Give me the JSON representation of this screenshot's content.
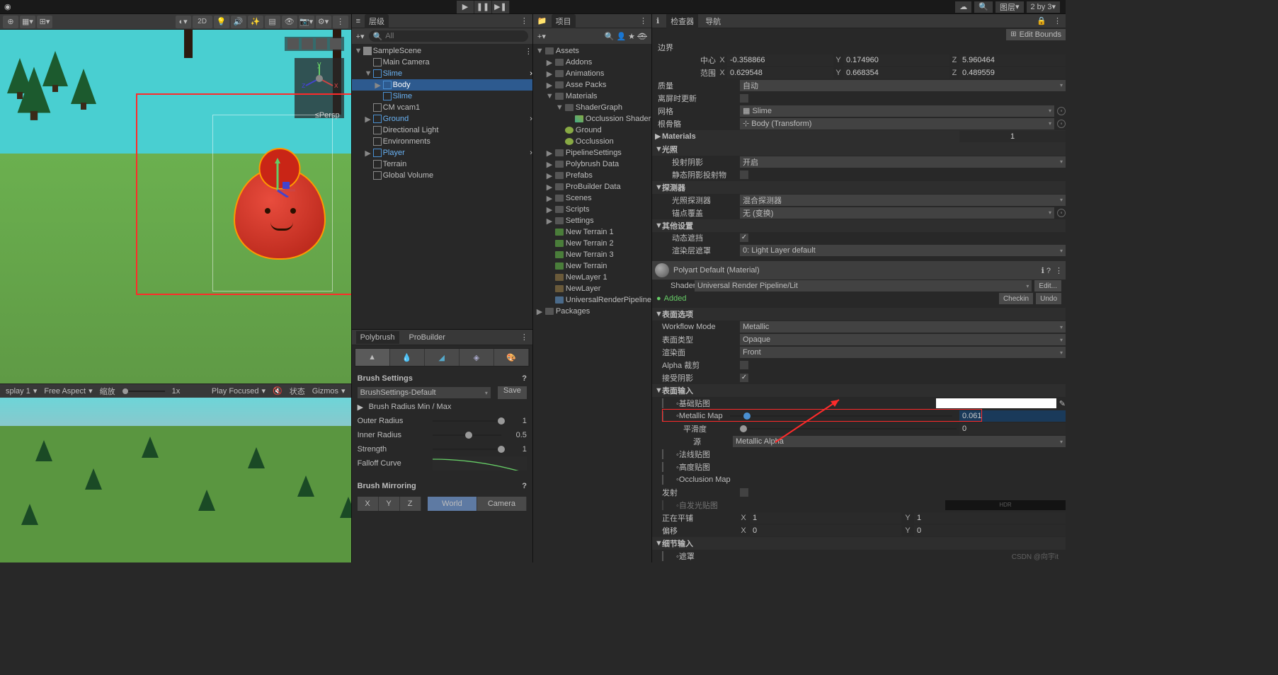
{
  "topbar": {
    "layout_dropdown": "图层",
    "ratio": "2 by 3"
  },
  "scene": {
    "persp": "≤Persp"
  },
  "gamebar": {
    "display": "splay 1",
    "aspect": "Free Aspect",
    "scale_label": "缩放",
    "scale_value": "1x",
    "playmode": "Play Focused",
    "status": "状态",
    "gizmos": "Gizmos"
  },
  "hierarchy": {
    "title": "层级",
    "search_placeholder": "All",
    "scene": "SampleScene",
    "items": [
      "Main Camera",
      "Slime",
      "Body",
      "Slime",
      "CM vcam1",
      "Ground",
      "Directional Light",
      "Environments",
      "Player",
      "Terrain",
      "Global Volume"
    ]
  },
  "polybrush": {
    "tab1": "Polybrush",
    "tab2": "ProBuilder",
    "brush_settings": "Brush Settings",
    "preset": "BrushSettings-Default",
    "save": "Save",
    "radius_hdr": "Brush Radius Min / Max",
    "outer": "Outer Radius",
    "outer_v": "1",
    "inner": "Inner Radius",
    "inner_v": "0.5",
    "strength": "Strength",
    "strength_v": "1",
    "falloff": "Falloff Curve",
    "mirroring": "Brush Mirroring",
    "axes": [
      "X",
      "Y",
      "Z"
    ],
    "world": "World",
    "camera": "Camera"
  },
  "project": {
    "title": "项目",
    "root": "Assets",
    "items": [
      "Addons",
      "Animations",
      "Asse Packs",
      "Materials",
      "ShaderGraph",
      "Occlussion Shader",
      "Ground",
      "Occlussion",
      "PipelineSettings",
      "Polybrush Data",
      "Prefabs",
      "ProBuilder Data",
      "Scenes",
      "Scripts",
      "Settings",
      "New Terrain 1",
      "New Terrain 2",
      "New Terrain 3",
      "New Terrain",
      "NewLayer 1",
      "NewLayer",
      "UniversalRenderPipeline"
    ],
    "packages": "Packages"
  },
  "inspector": {
    "tab1": "检查器",
    "tab2": "导航",
    "edit_bounds": "Edit Bounds",
    "bounds": "边界",
    "center": "中心",
    "center_x": "-0.358866",
    "center_y": "0.174960",
    "center_z": "5.960464",
    "extent": "范围",
    "extent_x": "0.629548",
    "extent_y": "0.668354",
    "extent_z": "0.489559",
    "quality_lbl": "质量",
    "quality_val": "自动",
    "offscreen": "离屏时更新",
    "mesh_lbl": "网格",
    "mesh_val": "Slime",
    "rootbone_lbl": "根骨骼",
    "rootbone_val": "Body (Transform)",
    "materials": "Materials",
    "materials_count": "1",
    "lighting": "光照",
    "castshadow_lbl": "投射阴影",
    "castshadow_val": "开启",
    "staticshadow": "静态阴影投射物",
    "probes": "探测器",
    "lightprobe_lbl": "光照探测器",
    "lightprobe_val": "混合探测器",
    "anchor_lbl": "锚点覆盖",
    "anchor_val": "无 (变换)",
    "other": "其他设置",
    "dynocc": "动态遮挡",
    "renderlayer_lbl": "渲染层遮罩",
    "renderlayer_val": "0: Light Layer default",
    "material_name": "Polyart Default (Material)",
    "shader_lbl": "Shader",
    "shader_val": "Universal Render Pipeline/Lit",
    "edit_btn": "Edit...",
    "added": "Added",
    "checkin": "Checkin",
    "undo": "Undo",
    "surface_opts": "表面选项",
    "workflow_lbl": "Workflow Mode",
    "workflow_val": "Metallic",
    "surftype_lbl": "表面类型",
    "surftype_val": "Opaque",
    "renderface_lbl": "渲染面",
    "renderface_val": "Front",
    "alphaclip": "Alpha 裁剪",
    "recvshadow": "接受阴影",
    "surface_in": "表面输入",
    "basemap": "基础贴图",
    "metallicmap": "Metallic Map",
    "metallic_val": "0.061",
    "smoothness": "平滑度",
    "smoothness_val": "0",
    "source_lbl": "源",
    "source_val": "Metallic Alpha",
    "normalmap": "法线贴图",
    "heightmap": "高度贴图",
    "occmap": "Occlusion Map",
    "emission": "发射",
    "emissionmap": "自发光贴图",
    "hdr": "HDR",
    "tiling": "正在平铺",
    "tile_x": "1",
    "tile_y": "1",
    "offset": "偏移",
    "off_x": "0",
    "off_y": "0",
    "detail_in": "细节输入",
    "mask": "遮罩"
  },
  "watermark": "CSDN @向宇it"
}
